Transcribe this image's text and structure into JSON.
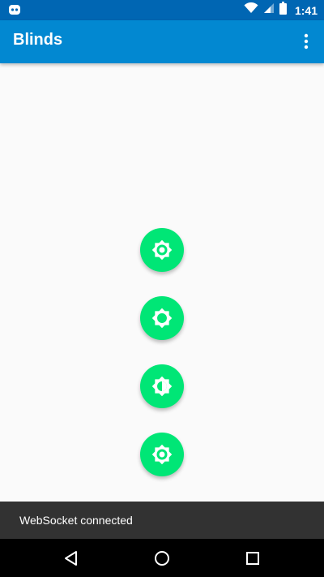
{
  "status_bar": {
    "time": "1:41",
    "icons": [
      "app-notification-icon",
      "wifi-icon",
      "signal-icon",
      "battery-icon"
    ]
  },
  "app_bar": {
    "title": "Blinds",
    "menu_icon": "overflow-menu-icon"
  },
  "controls": [
    {
      "icon": "brightness-low-icon"
    },
    {
      "icon": "brightness-medium-icon"
    },
    {
      "icon": "brightness-half-icon"
    },
    {
      "icon": "brightness-low-icon"
    }
  ],
  "snackbar": {
    "message": "WebSocket connected"
  },
  "navigation": {
    "icons": [
      "back-icon",
      "home-icon",
      "recent-apps-icon"
    ]
  },
  "colors": {
    "status_bar": "#0066b3",
    "app_bar": "#0288d1",
    "fab": "#00e676",
    "background": "#fafafa",
    "snackbar": "#323232",
    "nav_bar": "#000000"
  }
}
